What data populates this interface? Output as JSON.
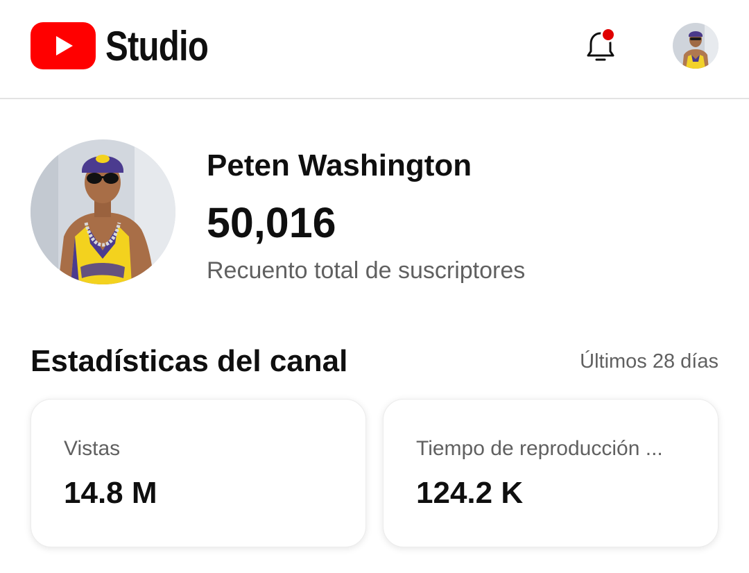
{
  "header": {
    "logo_text": "Studio",
    "brand_color": "#ff0000",
    "notification_icon": "bell-icon",
    "notification_badge_color": "#e00000"
  },
  "channel": {
    "name": "Peten Washington",
    "subscriber_count": "50,016",
    "subscriber_label": "Recuento total de suscriptores"
  },
  "stats": {
    "title": "Estadísticas del canal",
    "period": "Últimos 28 días",
    "cards": [
      {
        "label": "Vistas",
        "value": "14.8 M"
      },
      {
        "label": "Tiempo de reproducción ...",
        "value": "124.2 K"
      }
    ]
  }
}
